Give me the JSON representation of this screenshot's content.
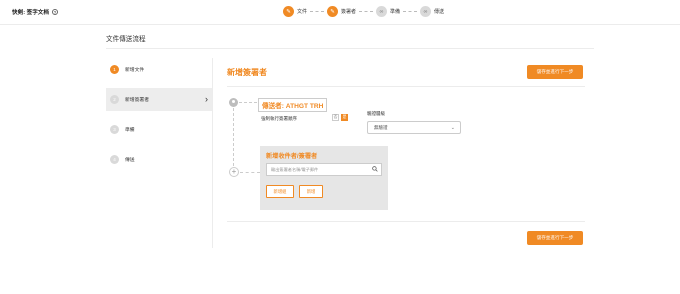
{
  "header": {
    "brand": "快剣: 签字文档",
    "help_icon": "help-circle-icon",
    "steps": [
      {
        "number": "1",
        "label": "文件",
        "state": "active"
      },
      {
        "number": "2",
        "label": "簽署者",
        "state": "active"
      },
      {
        "number": "3",
        "label": "準備",
        "state": "todo"
      },
      {
        "number": "4",
        "label": "傳送",
        "state": "todo"
      }
    ]
  },
  "page": {
    "title": "文件傳送流程"
  },
  "nav": {
    "items": [
      {
        "number": "1",
        "label": "新增文件",
        "selected": false,
        "done": true
      },
      {
        "number": "2",
        "label": "新增簽署者",
        "selected": true,
        "done": false
      },
      {
        "number": "3",
        "label": "準備",
        "selected": false,
        "done": false
      },
      {
        "number": "4",
        "label": "傳送",
        "selected": false,
        "done": false
      }
    ]
  },
  "main": {
    "title": "新增簽署者",
    "save_button": "儲存並進行下一步",
    "sender_label": "傳送者: ATHGT TRH",
    "order_label": "強制執行簽署順序",
    "toggle": {
      "off": "否",
      "on": "是"
    },
    "verify_label": "驗證層級",
    "verify_select": "無驗證",
    "add_panel": {
      "title": "新增收件者/簽署者",
      "search_placeholder": "輸出簽署者名稱/電子郵件",
      "add_group_button": "新增組",
      "add_button": "新增"
    },
    "save_button_bottom": "儲存並進行下一步"
  },
  "colors": {
    "accent": "#f08a24",
    "nav_selected_bg": "#ededed",
    "panel_bg": "#e6e6e6"
  }
}
